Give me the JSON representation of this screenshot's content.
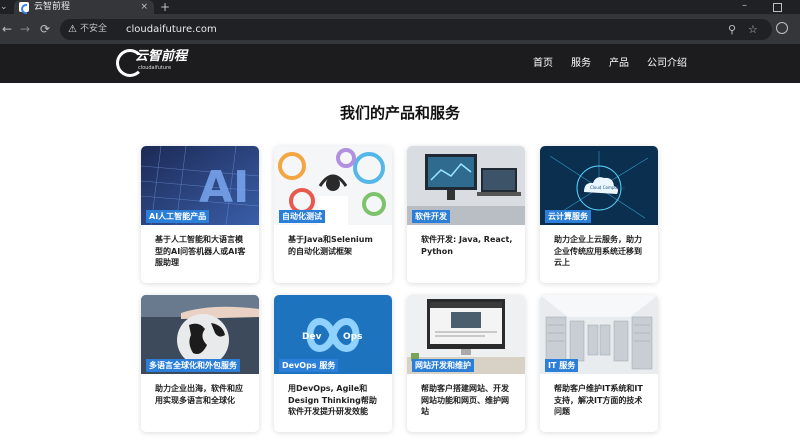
{
  "browser": {
    "tab_title": "云智前程",
    "tab_close": "×",
    "new_tab": "+",
    "insecure_label": "不安全",
    "url": "cloudaifuture.com"
  },
  "site": {
    "logo_text": "云智前程",
    "logo_sub": "cloudaifuture",
    "nav": [
      "首页",
      "服务",
      "产品",
      "公司介绍"
    ]
  },
  "section_title": "我们的产品和服务",
  "cards": [
    {
      "tag": "AI人工智能产品",
      "desc": "基于人工智能和大语言模型的AI问答机器人或AI客服助理"
    },
    {
      "tag": "自动化测试",
      "desc": "基于Java和Selenium的自动化测试框架"
    },
    {
      "tag": "软件开发",
      "desc": "软件开发: Java, React, Python"
    },
    {
      "tag": "云计算服务",
      "desc": "助力企业上云服务，助力企业传统应用系统迁移到云上"
    },
    {
      "tag": "多语言全球化和外包服务",
      "desc": "助力企业出海，软件和应用实现多语言和全球化"
    },
    {
      "tag": "DevOps 服务",
      "desc": "用DevOps, Agile和Design Thinking帮助软件开发提升研发效能"
    },
    {
      "tag": "网站开发和维护",
      "desc": "帮助客户搭建网站、开发网站功能和网页、维护网站"
    },
    {
      "tag": "IT 服务",
      "desc": "帮助客户维护IT系统和IT支持，解决IT方面的技术问题"
    }
  ],
  "images": {
    "ai_text": "AI",
    "cloud_text": "Cloud Computing",
    "devops_dev": "Dev",
    "devops_ops": "Ops"
  },
  "colors": {
    "header_bg": "#1c1c1e",
    "tag_bg": "#2b7fd9"
  }
}
